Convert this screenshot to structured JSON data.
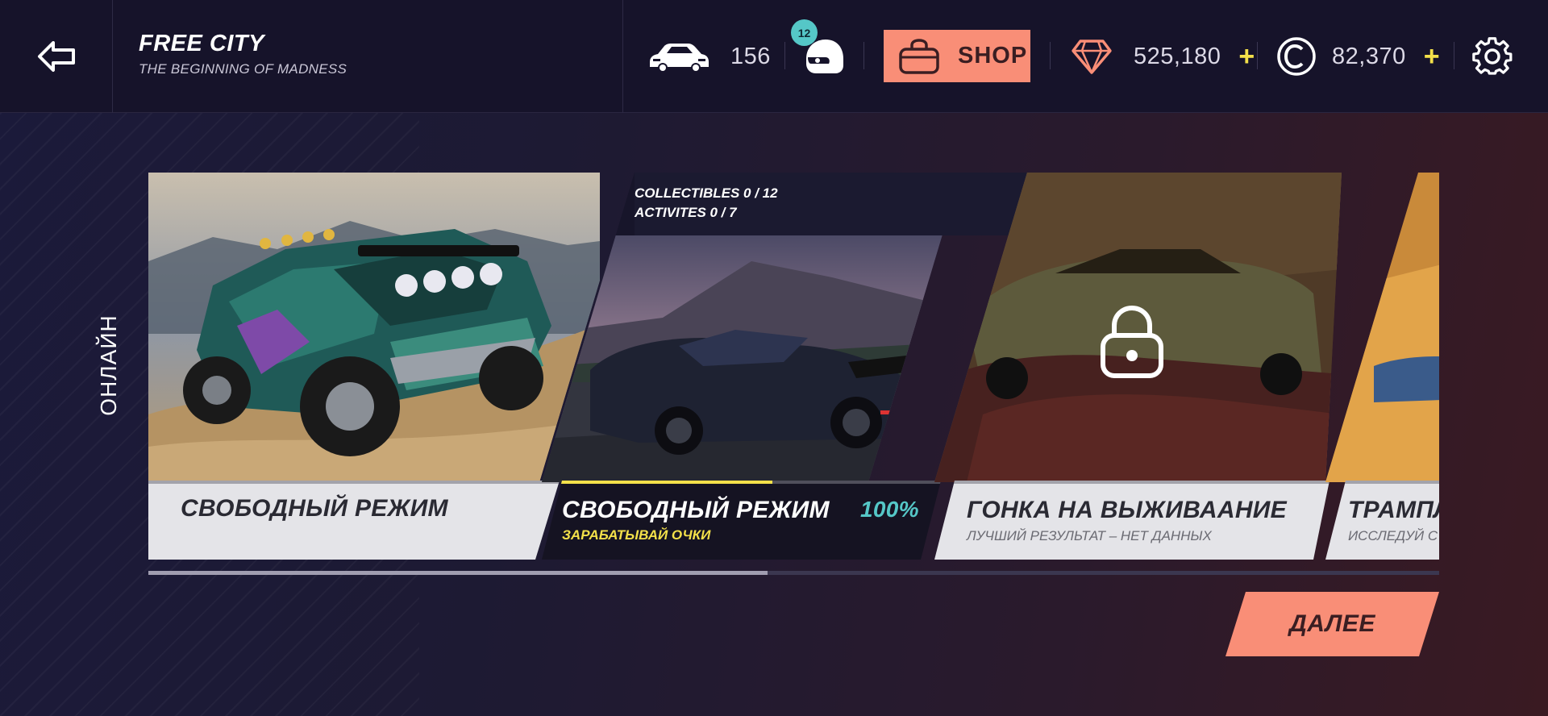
{
  "header": {
    "title": "FREE CITY",
    "subtitle": "THE BEGINNING OF MADNESS",
    "cars_count": "156",
    "helmet_badge": "12",
    "shop_label": "SHOP",
    "gems": "525,180",
    "credits": "82,370",
    "plus_symbol": "+"
  },
  "side_label": "ОНЛАЙН",
  "cards": [
    {
      "title": "СВОБОДНЫЙ РЕЖИМ",
      "subtitle": "",
      "state": "available"
    },
    {
      "title": "СВОБОДНЫЙ РЕЖИМ",
      "subtitle": "ЗАРАБАТЫВАЙ ОЧКИ",
      "percent": "100%",
      "collectibles": "COLLECTIBLES 0 / 12",
      "activities": "ACTIVITES 0 / 7",
      "progress_fraction": 0.55,
      "state": "selected"
    },
    {
      "title": "ГОНКА НА ВЫЖИВААНИЕ",
      "subtitle": "ЛУЧШИЙ РЕЗУЛЬТАТ –  НЕТ ДАННЫХ",
      "state": "locked"
    },
    {
      "title": "ТРАМПЛ",
      "subtitle": "ИССЛЕДУЙ С",
      "state": "partial"
    }
  ],
  "scroll_position_fraction": 0.48,
  "next_label": "ДАЛЕЕ",
  "colors": {
    "accent": "#f98e77",
    "highlight_yellow": "#f3e04a",
    "teal": "#55c7c7",
    "topbar": "#16132a"
  },
  "icons": [
    "back-arrow-icon",
    "car-icon",
    "helmet-icon",
    "bag-icon",
    "diamond-icon",
    "credit-coin-icon",
    "gear-icon",
    "lock-icon"
  ]
}
